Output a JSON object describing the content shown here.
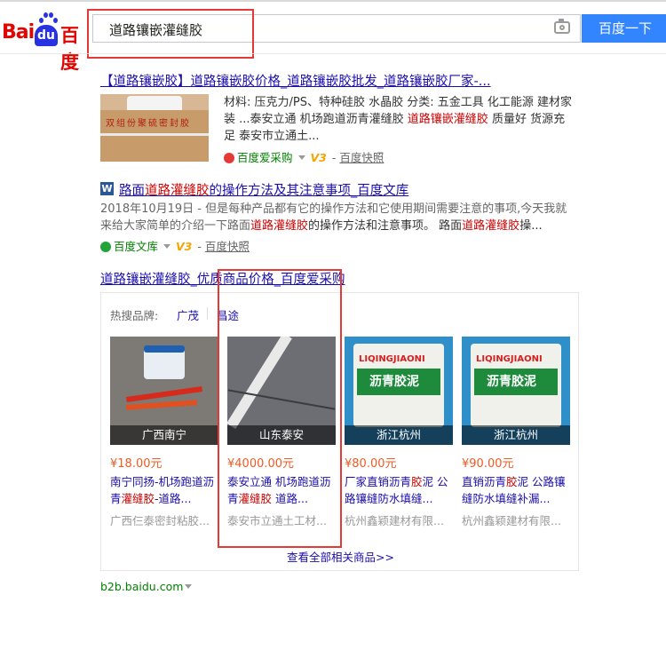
{
  "header": {
    "logo": {
      "bai": "Bai",
      "du": "du",
      "cn": "百度"
    },
    "query": "道路镶嵌灌缝胶",
    "search_button": "百度一下",
    "camera_icon": "camera-icon"
  },
  "results": [
    {
      "title_parts": [
        "【道路镶嵌胶】道路镶嵌胶价格_道路镶嵌胶批发_道路镶嵌胶厂家-..."
      ],
      "abstract_pre": "材料: 压克力/PS、特种硅胶 水晶胶 分类: 五金工具 化工能源 建材家装 ...泰安立通 机场跑道沥青灌缝胶 ",
      "abstract_red": "道路镶嵌灌缝胶",
      "abstract_post": " 质量好 货源充足 泰安市立通土...",
      "thumb_text": "双组份聚硫密封胶",
      "source": "百度爱采购",
      "badge": "V3",
      "snapshot": "百度快照"
    },
    {
      "title_pre": "路面",
      "title_red": "道路灌缝胶",
      "title_post": "的操作方法及其注意事项_百度文库",
      "abstract_pre": "2018年10月19日 - 但是每种产品都有它的操作方法和它使用期间需要注意的事项,今天我就来给大家简单的介绍一下路面",
      "abstract_red1": "道路灌缝胶",
      "abstract_mid": "的操作方法和注意事项。 路面",
      "abstract_red2": "道路灌缝胶",
      "abstract_post": "操...",
      "source": "百度文库",
      "badge": "V3",
      "snapshot": "百度快照"
    }
  ],
  "shopping": {
    "title": "道路镶嵌灌缝胶_优质商品价格_百度爱采购",
    "hot_label": "热搜品牌:",
    "brands": [
      "广茂",
      "昌途"
    ],
    "products": [
      {
        "location": "广西南宁",
        "price": "¥18.00元",
        "name_pre": "南宁同扬-机场跑道沥青",
        "name_red": "灌缝胶",
        "name_post": "-道路...",
        "shop": "广西仨泰密封粘胶..."
      },
      {
        "location": "山东泰安",
        "price": "¥4000.00元",
        "name_pre": "泰安立通 机场跑道沥青",
        "name_red": "灌缝胶",
        "name_post": " 道路...",
        "shop": "泰安市立通土工材..."
      },
      {
        "location": "浙江杭州",
        "price": "¥80.00元",
        "name_pre": "厂家直销沥青",
        "name_red": "胶",
        "name_post": "泥 公路镶缝防水填缝...",
        "shop": "杭州鑫颖建材有限..."
      },
      {
        "location": "浙江杭州",
        "price": "¥90.00元",
        "name_pre": "直销沥青",
        "name_red": "胶",
        "name_post": "泥 公路镶缝防水填缝补漏...",
        "shop": "杭州鑫颖建材有限..."
      }
    ],
    "product_label_text": "LIQINGJIAONI",
    "product_label_cn": "沥青胶泥",
    "more": "查看全部相关商品>>",
    "domain": "b2b.baidu.com"
  }
}
